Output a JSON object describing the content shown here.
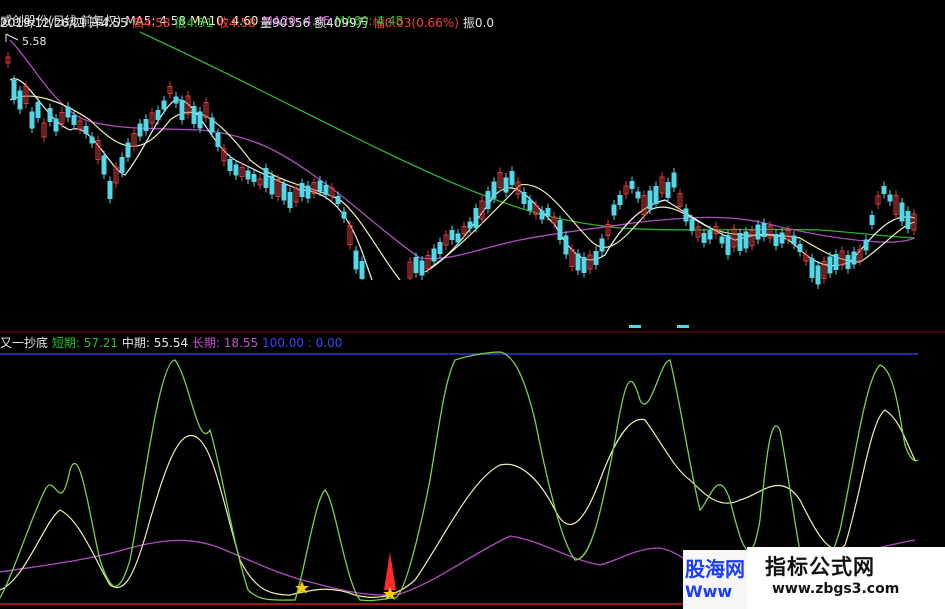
{
  "header": {
    "stock": "威创股份(日线,前复权)",
    "ma5": "MA5: 4.58",
    "ma10": "MA10: 4.60",
    "ma20": "MA20: 4.45",
    "ma60": "MA60: 4.48",
    "date_open_prefix": "2019/12/26/四 开4.55",
    "high": "高4.58",
    "low": "低4.51",
    "close": "收4.58",
    "volume": "量90356",
    "amount": "额4099万",
    "change": "幅0.03(0.66%)",
    "amplitude": "振0.0"
  },
  "price_marker": "5.58",
  "indicator": {
    "name": "又一抄底",
    "short": "短期: 57.21",
    "mid": "中期: 55.54",
    "long": "长期: 18.55",
    "extra": "100.00 : 0.00"
  },
  "watermark": {
    "title": "指标公式网",
    "url": "www.zbgs3.com",
    "title2": "股海网",
    "url2": "Www"
  },
  "colors": {
    "bg": "#000000",
    "up_candle": "#e23b3b",
    "down_candle": "#54d8e8",
    "ma_white": "#f2f2f2",
    "ma_yellow": "#f0f0b0",
    "ma_magenta": "#b04ec0",
    "ma_green": "#2fae2f",
    "short_line": "#79d34a",
    "mid_line": "#f0f0b0",
    "long_line": "#b04ec0",
    "top_line": "#3a44ff",
    "separator": "#7a1010"
  }
}
